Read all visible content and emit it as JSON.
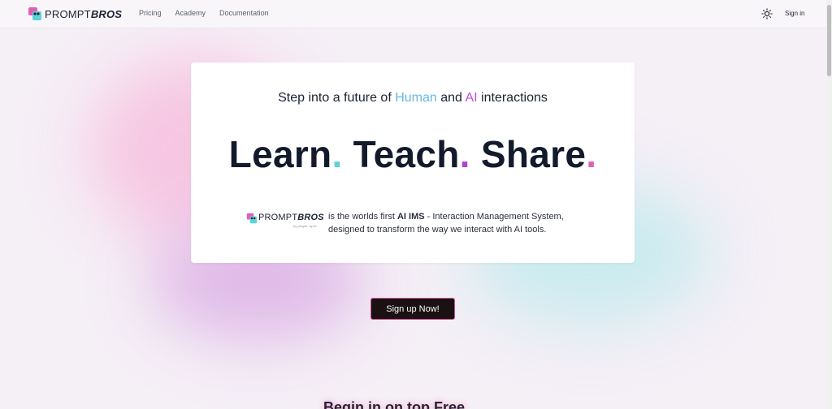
{
  "header": {
    "logo_prefix": "PROMPT",
    "logo_suffix": "BROS",
    "nav": [
      "Pricing",
      "Academy",
      "Documentation"
    ],
    "theme_icon": "sun-icon",
    "signin_label": "Sign in"
  },
  "hero": {
    "tagline_prefix": "Step into a future of ",
    "tagline_human": "Human",
    "tagline_and": " and ",
    "tagline_ai": "AI",
    "tagline_suffix": " interactions",
    "headline_words": [
      "Learn",
      "Teach",
      "Share"
    ],
    "headline_dot": ".",
    "inline_logo_prefix": "PROMPT",
    "inline_logo_suffix": "BROS",
    "inline_logo_sub": "by people, by AI",
    "desc_prefix": "is the worlds first ",
    "desc_bold": "AI IMS",
    "desc_suffix": " - Interaction Management System, designed to transform the way we interact with AI tools."
  },
  "cta": {
    "label": "Sign up Now!"
  },
  "section": {
    "heading_partial": "Begin in on top Free"
  },
  "colors": {
    "accent_teal": "#5bd3d8",
    "accent_purple": "#b442d4",
    "accent_pink": "#e05fb5",
    "human_blue": "#69b6e6"
  }
}
